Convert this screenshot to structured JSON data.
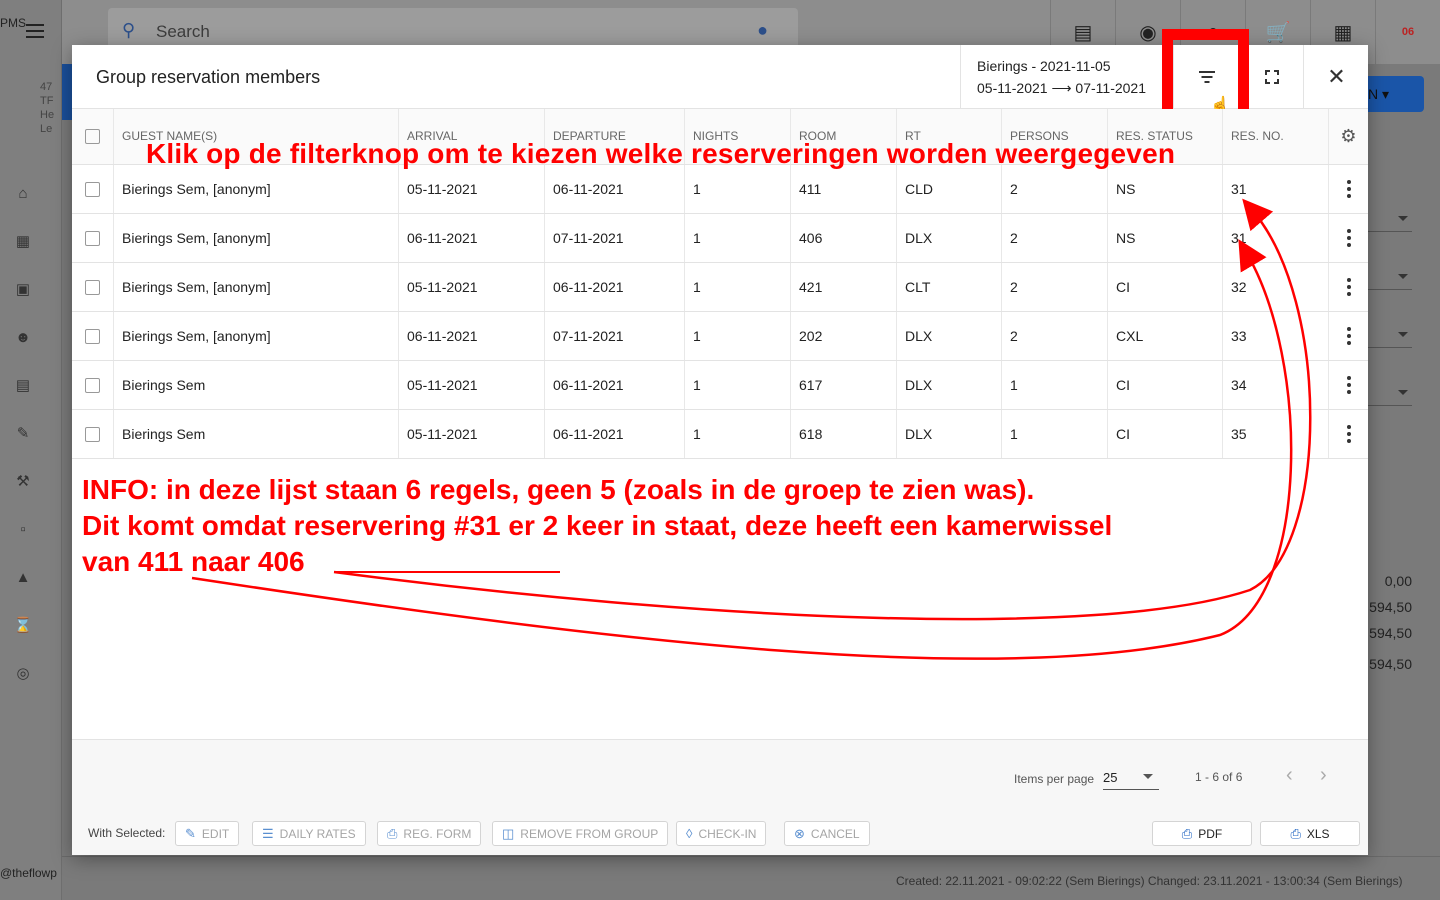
{
  "background": {
    "app_label": "PMS",
    "search_placeholder": "Search",
    "calendar_badge": "06",
    "footer_handle": "@theflowp",
    "footer_meta": "Created: 22.11.2021 - 09:02:22 (Sem Bierings)    Changed: 23.11.2021 - 13:00:34 (Sem Bierings)",
    "side_fragment": [
      "47",
      "TF",
      "He",
      "Le"
    ],
    "right_values": [
      "0,00",
      "594,50",
      "594,50",
      "594,50"
    ],
    "right_button": "N"
  },
  "modal": {
    "title": "Group reservation members",
    "group_name": "Bierings - 2021-11-05",
    "date_range": "05-11-2021 ⟶ 07-11-2021"
  },
  "table": {
    "headers": [
      "GUEST NAME(S)",
      "ARRIVAL",
      "DEPARTURE",
      "NIGHTS",
      "ROOM",
      "RT",
      "PERSONS",
      "RES. STATUS",
      "RES. NO."
    ],
    "rows": [
      [
        "Bierings Sem, [anonym]",
        "05-11-2021",
        "06-11-2021",
        "1",
        "411",
        "CLD",
        "2",
        "NS",
        "31"
      ],
      [
        "Bierings Sem, [anonym]",
        "06-11-2021",
        "07-11-2021",
        "1",
        "406",
        "DLX",
        "2",
        "NS",
        "31"
      ],
      [
        "Bierings Sem, [anonym]",
        "05-11-2021",
        "06-11-2021",
        "1",
        "421",
        "CLT",
        "2",
        "CI",
        "32"
      ],
      [
        "Bierings Sem, [anonym]",
        "06-11-2021",
        "07-11-2021",
        "1",
        "202",
        "DLX",
        "2",
        "CXL",
        "33"
      ],
      [
        "Bierings Sem",
        "05-11-2021",
        "06-11-2021",
        "1",
        "617",
        "DLX",
        "1",
        "CI",
        "34"
      ],
      [
        "Bierings Sem",
        "05-11-2021",
        "06-11-2021",
        "1",
        "618",
        "DLX",
        "1",
        "CI",
        "35"
      ]
    ]
  },
  "pagination": {
    "items_per_page_label": "Items per page",
    "items_per_page": "25",
    "range": "1 - 6 of 6"
  },
  "actions": {
    "with_selected": "With Selected:",
    "edit": "EDIT",
    "daily_rates": "DAILY RATES",
    "reg_form": "REG. FORM",
    "remove": "REMOVE FROM GROUP",
    "checkin": "CHECK-IN",
    "cancel": "CANCEL",
    "pdf": "PDF",
    "xls": "XLS"
  },
  "annotations": {
    "top": "Klik op de filterknop om te kiezen welke reserveringen worden weergegeven",
    "info_line1": "INFO: in deze lijst staan 6 regels, geen 5 (zoals in de groep te zien was).",
    "info_line2": "Dit komt omdat reservering #31 er 2 keer in staat, deze heeft een kamerwissel",
    "info_line3": "van 411 naar 406",
    "color": "#ff0000"
  }
}
